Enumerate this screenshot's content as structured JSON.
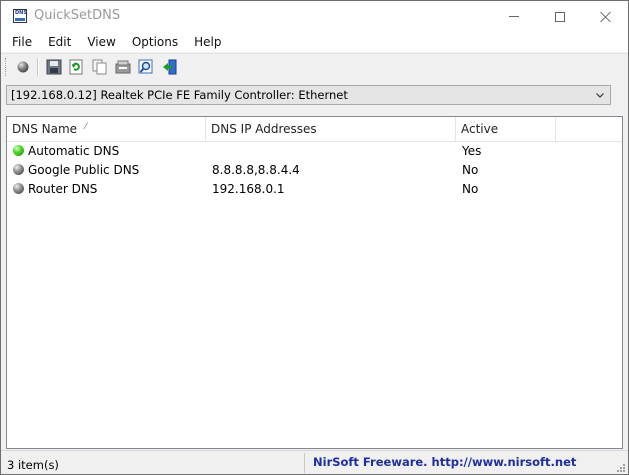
{
  "window": {
    "title": "QuickSetDNS"
  },
  "menu": {
    "items": [
      {
        "label": "File"
      },
      {
        "label": "Edit"
      },
      {
        "label": "View"
      },
      {
        "label": "Options"
      },
      {
        "label": "Help"
      }
    ]
  },
  "toolbar": {
    "buttons": [
      {
        "icon": "gray-circle-icon"
      },
      {
        "icon": "save-icon"
      },
      {
        "icon": "refresh-icon"
      },
      {
        "icon": "copy-icon"
      },
      {
        "icon": "properties-icon"
      },
      {
        "icon": "find-icon"
      },
      {
        "icon": "exit-icon"
      }
    ]
  },
  "adapter": {
    "selected": "[192.168.0.12]  Realtek PCIe FE Family Controller: Ethernet"
  },
  "list": {
    "columns": [
      {
        "label": "DNS Name",
        "sort_indicator": "⁄"
      },
      {
        "label": "DNS IP Addresses"
      },
      {
        "label": "Active"
      }
    ],
    "rows": [
      {
        "status": "green",
        "name": "Automatic DNS",
        "ips": "",
        "active": "Yes"
      },
      {
        "status": "gray",
        "name": "Google Public DNS",
        "ips": "8.8.8.8,8.8.4.4",
        "active": "No"
      },
      {
        "status": "gray",
        "name": "Router DNS",
        "ips": "192.168.0.1",
        "active": "No"
      }
    ]
  },
  "status": {
    "count": "3 item(s)",
    "link": "NirSoft Freeware.  http://www.nirsoft.net"
  },
  "colors": {
    "link": "#1e2f9c",
    "active_green": "#4ed62a",
    "inactive_gray": "#8a8a8a"
  }
}
